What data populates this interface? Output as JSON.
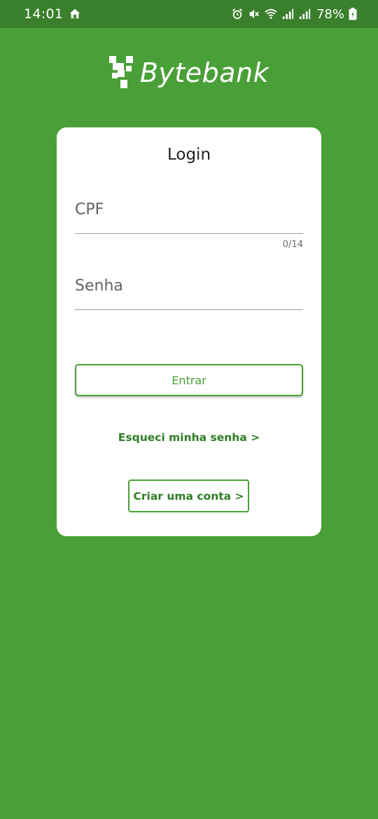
{
  "status_bar": {
    "time": "14:01",
    "battery": "78%",
    "icons": [
      "home-icon",
      "alarm-icon",
      "mute-icon",
      "wifi-icon",
      "signal-icon",
      "signal-icon",
      "battery-icon"
    ]
  },
  "brand": {
    "name": "Bytebank"
  },
  "login": {
    "title": "Login",
    "cpf_placeholder": "CPF",
    "cpf_counter": "0/14",
    "password_placeholder": "Senha",
    "submit_label": "Entrar",
    "forgot_password_label": "Esqueci minha senha >",
    "create_account_label": "Criar uma conta >"
  },
  "colors": {
    "background": "#4aa038",
    "status_bar": "#3a7f2c",
    "accent": "#4aa038",
    "link": "#2f7d26",
    "card": "#ffffff"
  }
}
